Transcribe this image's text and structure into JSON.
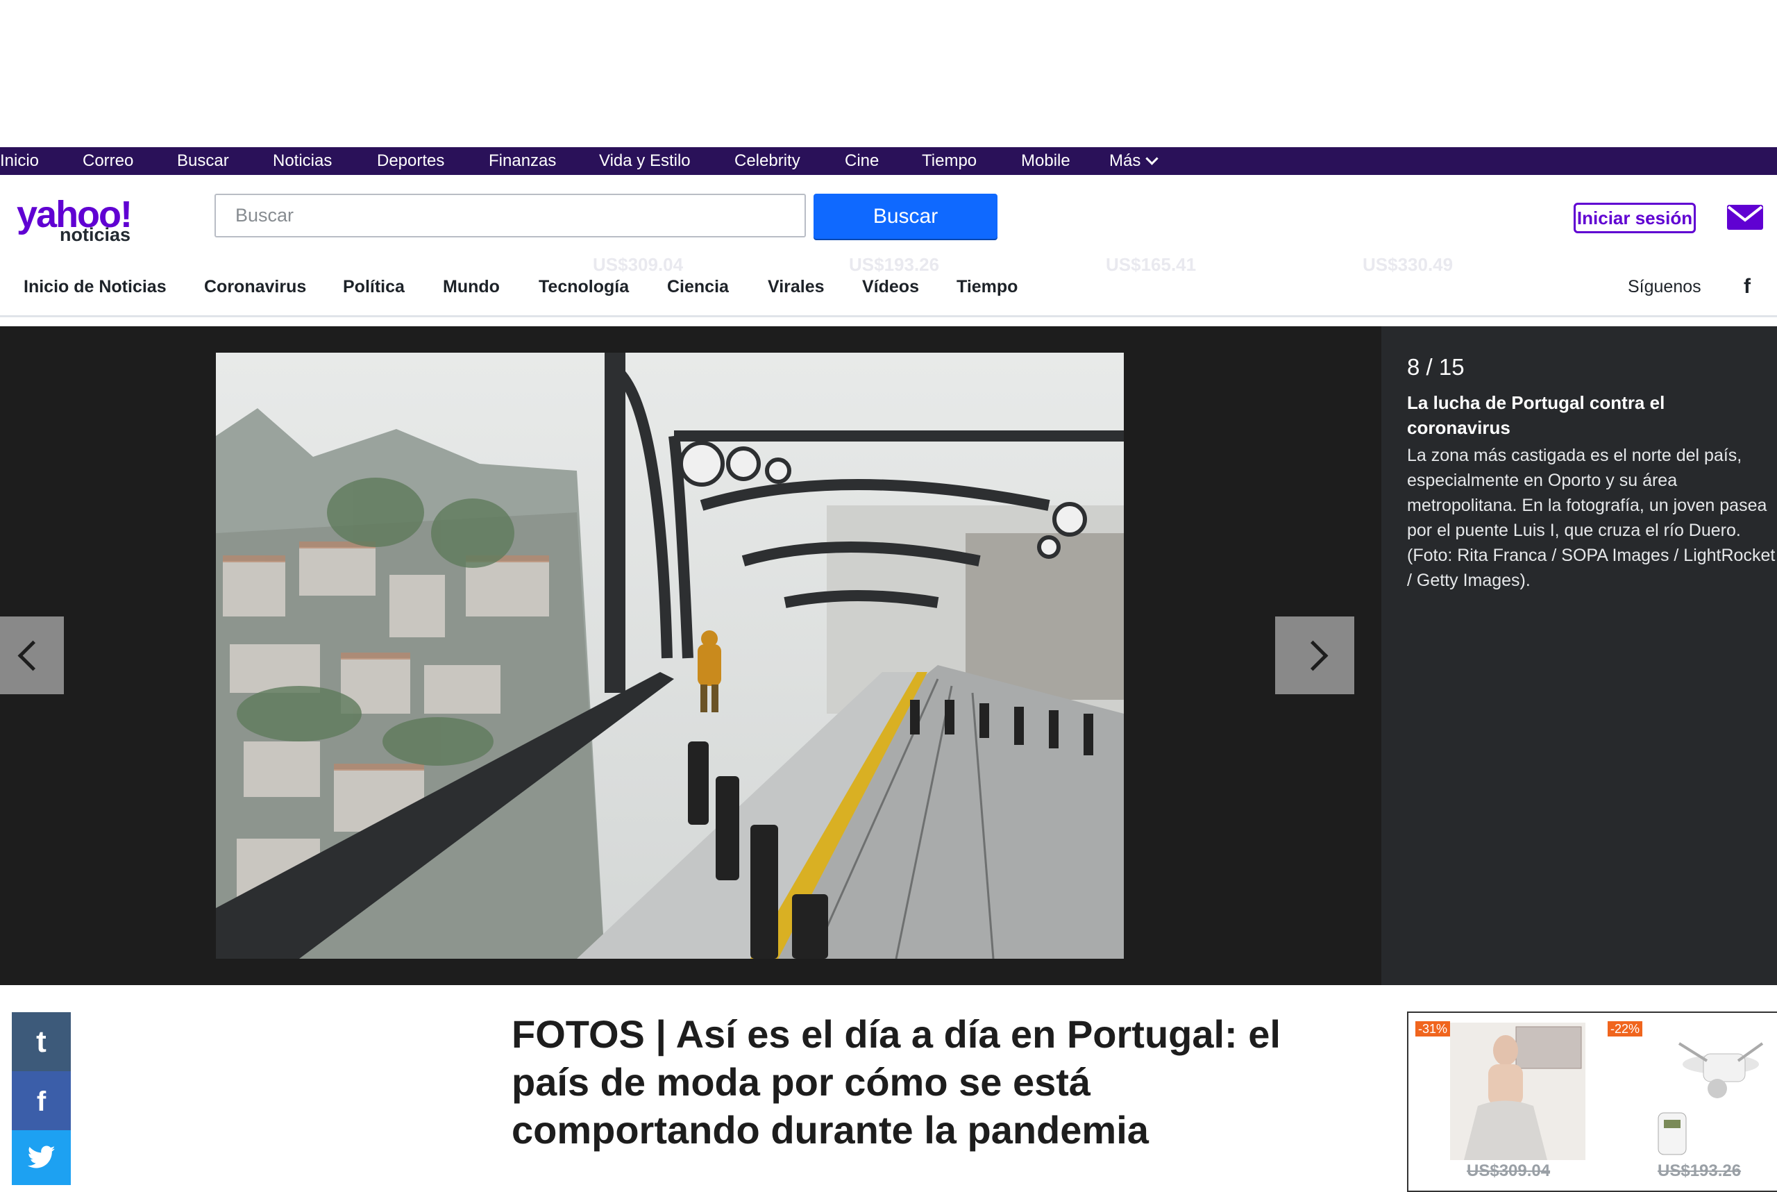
{
  "topnav": {
    "items": [
      "Inicio",
      "Correo",
      "Buscar",
      "Noticias",
      "Deportes",
      "Finanzas",
      "Vida y Estilo",
      "Celebrity",
      "Cine",
      "Tiempo",
      "Mobile"
    ],
    "more": "Más"
  },
  "header": {
    "logo_main": "yahoo!",
    "logo_sub": "noticias",
    "search_placeholder": "Buscar",
    "search_button": "Buscar",
    "signin": "Iniciar sesión"
  },
  "ad_ghost": [
    "US$309.04",
    "US$193.26",
    "US$165.41",
    "US$330.49"
  ],
  "subnav": {
    "items": [
      "Inicio de Noticias",
      "Coronavirus",
      "Política",
      "Mundo",
      "Tecnología",
      "Ciencia",
      "Virales",
      "Vídeos",
      "Tiempo"
    ],
    "follow": "Síguenos",
    "follow_fb": "f"
  },
  "slideshow": {
    "counter": "8 / 15",
    "title": "La lucha de Portugal contra el coronavirus",
    "caption": "La zona más castigada es el norte del país, especialmente en Oporto y su área metropolitana. En la fotografía, un joven pasea por el puente Luis I, que cruza el río Duero. (Foto: Rita Franca / SOPA Images / LightRocket / Getty Images)."
  },
  "article": {
    "headline": "FOTOS | Así es el día a día en Portugal: el país de moda por cómo se está comportando durante la pandemia"
  },
  "share": {
    "tumblr": "t",
    "facebook": "f"
  },
  "ad": {
    "items": [
      {
        "discount": "-31%",
        "price": "US$309.04"
      },
      {
        "discount": "-22%",
        "price": "US$193.26"
      }
    ]
  },
  "colors": {
    "yahoo_purple": "#6001d2",
    "topnav_bg": "#2a1159",
    "search_blue": "#0f69ff",
    "slideshow_bg": "#1d1d1d"
  }
}
